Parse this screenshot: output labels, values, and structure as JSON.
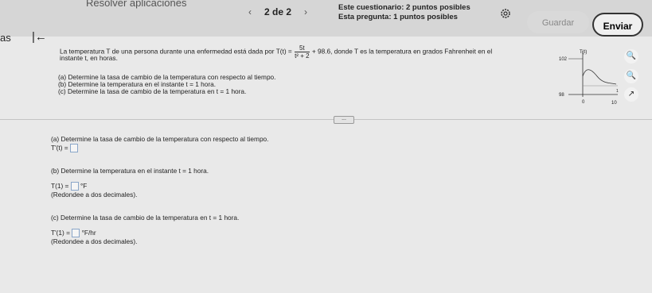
{
  "header": {
    "app_title": "Resolver aplicaciones",
    "prev_icon": "chevron-left-icon",
    "page_indicator": "2 de 2",
    "next_icon": "chevron-right-icon",
    "quiz_points": "Este cuestionario: 2 puntos posibles",
    "question_points": "Esta pregunta: 1 puntos posibles",
    "save_label": "Guardar",
    "send_label": "Enviar"
  },
  "nav": {
    "side_label": "as"
  },
  "question": {
    "intro_a": "La temperatura T de una persona durante una enfermedad está dada por",
    "fn_lhs": "T(t) =",
    "frac_num": "5t",
    "frac_den": "t² + 2",
    "intro_b": "+ 98.6, donde T es la temperatura en grados Fahrenheit en el",
    "intro_c": "instante t, en horas.",
    "part_a": "(a) Determine la tasa de cambio de la temperatura con respecto al tiempo.",
    "part_b": "(b) Determine la temperatura en el instante t = 1 hora.",
    "part_c": "(c) Determine la tasa de cambio de la temperatura en t = 1 hora."
  },
  "graph": {
    "y_axis_label": "T(t)",
    "y_max": "102",
    "y_min": "98",
    "x_min": "0",
    "x_max": "10",
    "extra_tick": "1"
  },
  "more": "...",
  "answers": {
    "a_prompt": "(a) Determine la tasa de cambio de la temperatura con respecto al tiempo.",
    "a_lhs": "T'(t) =",
    "b_prompt": "(b) Determine la temperatura en el instante t = 1 hora.",
    "b_lhs": "T(1) =",
    "b_unit": "°F",
    "b_note": "(Redondee a dos decimales).",
    "c_prompt": "(c) Determine la tasa de cambio de la temperatura en t = 1 hora.",
    "c_lhs": "T'(1) =",
    "c_unit": "°F/hr",
    "c_note": "(Redondee a dos decimales)."
  }
}
